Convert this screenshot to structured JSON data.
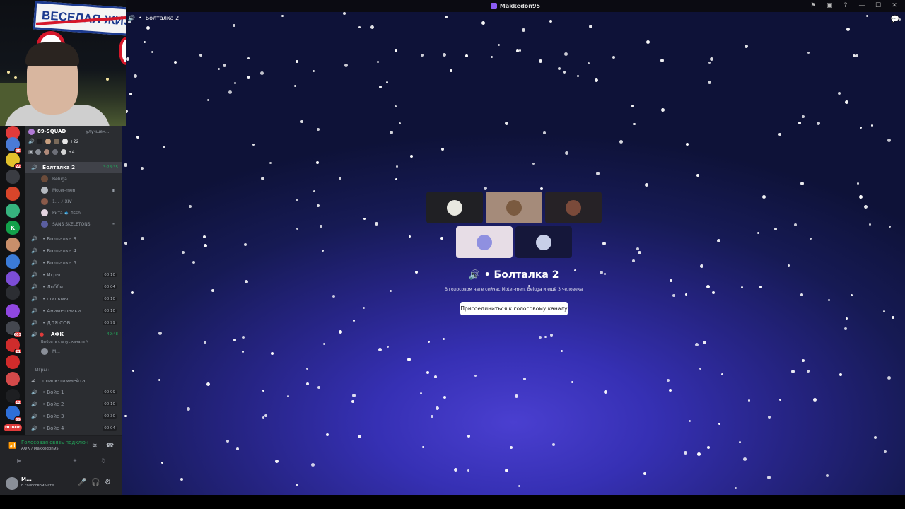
{
  "window": {
    "title": "Makkedon95",
    "controls": [
      "⚑",
      "▣",
      "?",
      "—",
      "☐",
      "✕"
    ]
  },
  "webcam": {
    "sign_text": "ВЕСЕЛАЯ ЖИЗ",
    "speed_text": "50"
  },
  "servers": {
    "new_badge": "НОВОЕ",
    "items": [
      {
        "letter": "",
        "color": "#e03b3b",
        "badge": ""
      },
      {
        "letter": "",
        "color": "#4a7bd6",
        "badge": "35"
      },
      {
        "letter": "",
        "color": "#e2c12c",
        "badge": "22"
      },
      {
        "letter": "",
        "color": "#3a3c42",
        "badge": ""
      },
      {
        "letter": "",
        "color": "#d8452a",
        "badge": ""
      },
      {
        "letter": "",
        "color": "#36b37e",
        "badge": ""
      },
      {
        "letter": "K",
        "color": "#12a04a",
        "badge": ""
      },
      {
        "letter": "",
        "color": "#c98f6b",
        "badge": ""
      },
      {
        "letter": "",
        "color": "#3b7bd8",
        "badge": ""
      },
      {
        "letter": "",
        "color": "#7c4dd6",
        "badge": ""
      },
      {
        "letter": "",
        "color": "#2c2e33",
        "badge": ""
      },
      {
        "letter": "",
        "color": "#8f47e0",
        "badge": ""
      },
      {
        "letter": "",
        "color": "#44474f",
        "badge": "603"
      },
      {
        "letter": "",
        "color": "#cf2c2c",
        "badge": "21"
      },
      {
        "letter": "",
        "color": "#d12b2b",
        "badge": ""
      },
      {
        "letter": "",
        "color": "#d44a4a",
        "badge": ""
      },
      {
        "letter": "",
        "color": "#1e1f22",
        "badge": "12"
      },
      {
        "letter": "",
        "color": "#2e6fd8",
        "badge": "69"
      }
    ]
  },
  "sidebar": {
    "server_name": "89-SQUAD",
    "boost_text": "улучшен...",
    "stack1_count": "+22",
    "stack2_count": "+4",
    "active_channel": {
      "name": "Болталка 2",
      "timer": "3:28:35"
    },
    "members": [
      {
        "name": "Beluga",
        "cam": ""
      },
      {
        "name": "Moter-men",
        "cam": "▮"
      },
      {
        "name": "1... ⚡ XIV",
        "cam": ""
      },
      {
        "name": "Рита 🐟 fisch",
        "cam": ""
      },
      {
        "name": "SANS SKELETONS",
        "cam": "⏸"
      }
    ],
    "channels": [
      {
        "name": "Болталка 3",
        "count": ""
      },
      {
        "name": "Болталка 4",
        "count": ""
      },
      {
        "name": "Болталка 5",
        "count": ""
      },
      {
        "name": "Игры",
        "count": "00 10"
      },
      {
        "name": "Лобби",
        "count": "00 04"
      },
      {
        "name": "фильмы",
        "count": "00 10"
      },
      {
        "name": "Анимешники",
        "count": "00 10"
      },
      {
        "name": "ДЛЯ СОБ...",
        "count": "00 99"
      }
    ],
    "afk_channel": {
      "name": "АФК",
      "timer": "49:48",
      "status": "Выбрать статус канала ✎",
      "member": "M..."
    },
    "category": "Игры",
    "text_channel": "поиск-тиммейта",
    "game_channels": [
      {
        "name": "Войс 1",
        "count": "00 99"
      },
      {
        "name": "Войс 2",
        "count": "00 10"
      },
      {
        "name": "Войс 3",
        "count": "00 30"
      },
      {
        "name": "Войс 4",
        "count": "00 04"
      }
    ]
  },
  "voice_panel": {
    "title": "Голосовая связь подключена",
    "subtitle": "АФК / Makkedon95"
  },
  "user_panel": {
    "name": "M...",
    "status": "В голосовом чате"
  },
  "stage": {
    "header_channel": "Болталка 2",
    "channel_title": "Болталка 2",
    "subtitle": "В голосовом чате сейчас Moter-men, Beluga и ещё 3 человека",
    "join_label": "Присоединиться к голосовому каналу",
    "tiles": [
      {
        "bg": "#202024",
        "av": "#e8e8e0"
      },
      {
        "bg": "#a58b7a",
        "av": "#7a5a40"
      },
      {
        "bg": "#262226",
        "av": "#7a4a3a"
      },
      {
        "bg": "#e7dde6",
        "av": "#8f90e0"
      },
      {
        "bg": "#15173a",
        "av": "#c8cfe8"
      }
    ]
  }
}
